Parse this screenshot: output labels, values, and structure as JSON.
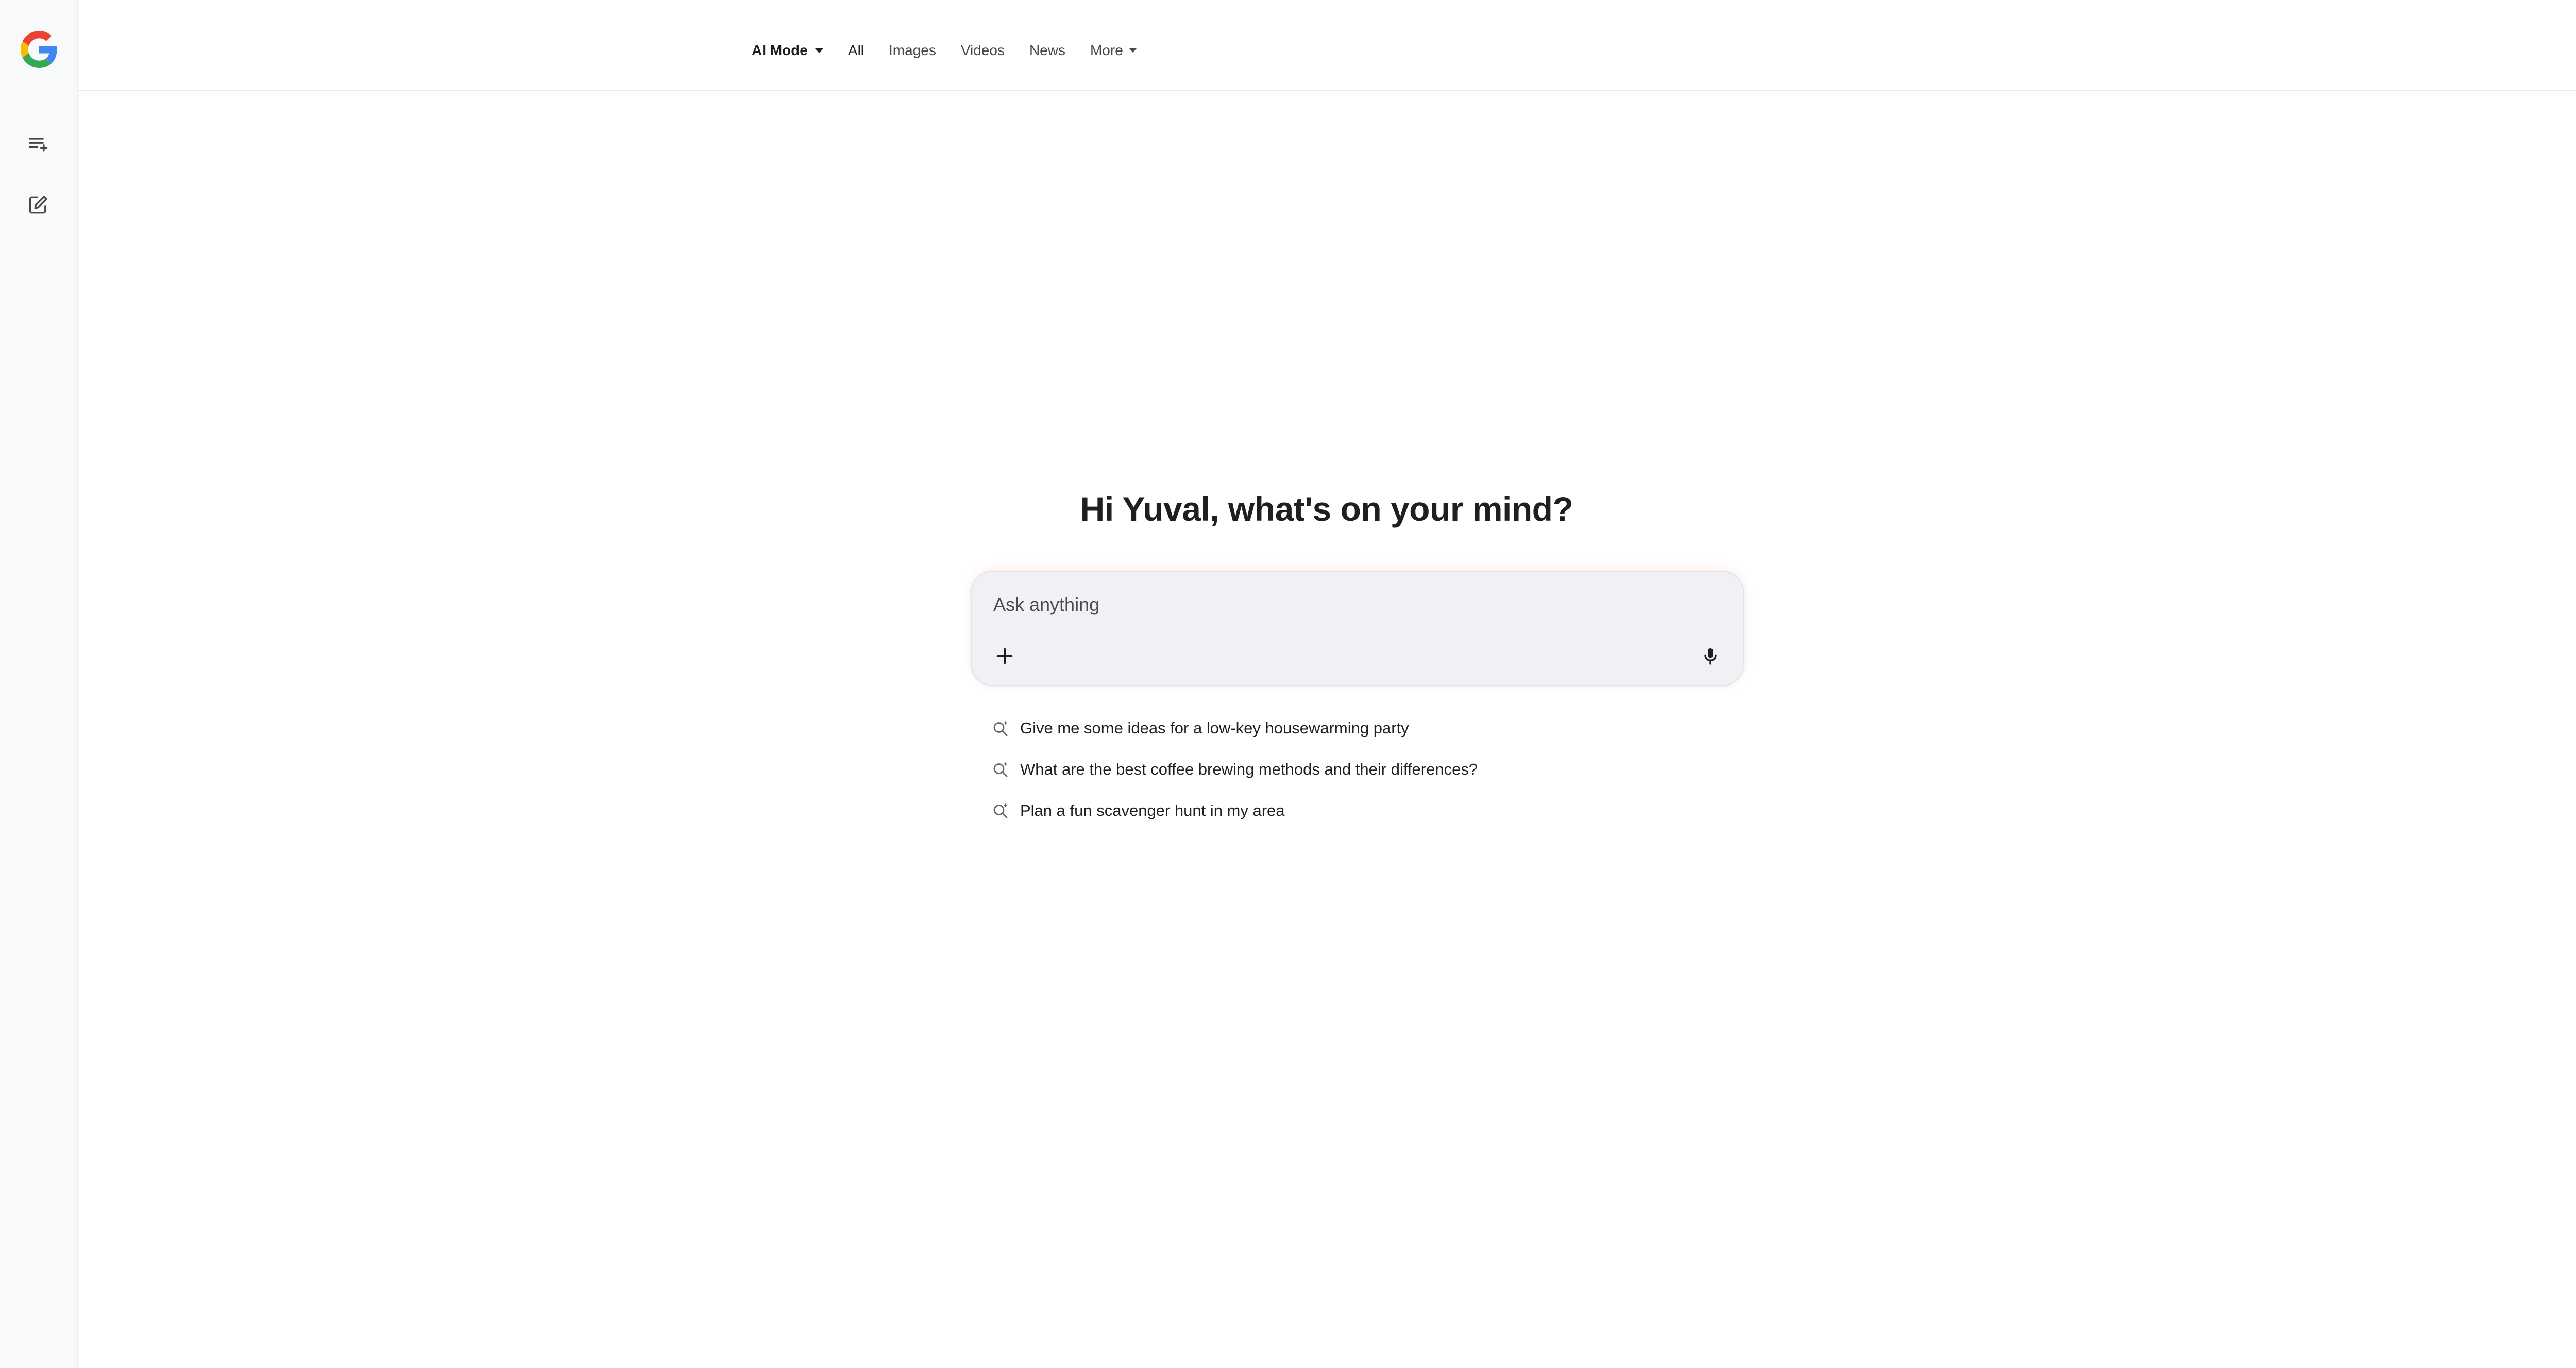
{
  "nav": {
    "tabs": [
      {
        "label": "AI Mode"
      },
      {
        "label": "All"
      },
      {
        "label": "Images"
      },
      {
        "label": "Videos"
      },
      {
        "label": "News"
      },
      {
        "label": "More"
      }
    ]
  },
  "greeting": "Hi Yuval, what's on your mind?",
  "search": {
    "placeholder": "Ask anything",
    "value": ""
  },
  "suggestions": [
    {
      "text": "Give me some ideas for a low-key housewarming party"
    },
    {
      "text": "What are the best coffee brewing methods and their differences?"
    },
    {
      "text": "Plan a fun scavenger hunt in my area"
    }
  ],
  "icons": {
    "logo": "google-g-icon",
    "history": "history-list-icon",
    "new_chat": "new-chat-icon",
    "apps": "apps-grid-icon",
    "plus": "plus-icon",
    "mic": "mic-icon",
    "suggestion": "search-sparkle-icon"
  },
  "colors": {
    "text": "#1f1f1f",
    "rail_bg": "#f8f9fa",
    "search_bg": "#f0f1f4"
  }
}
